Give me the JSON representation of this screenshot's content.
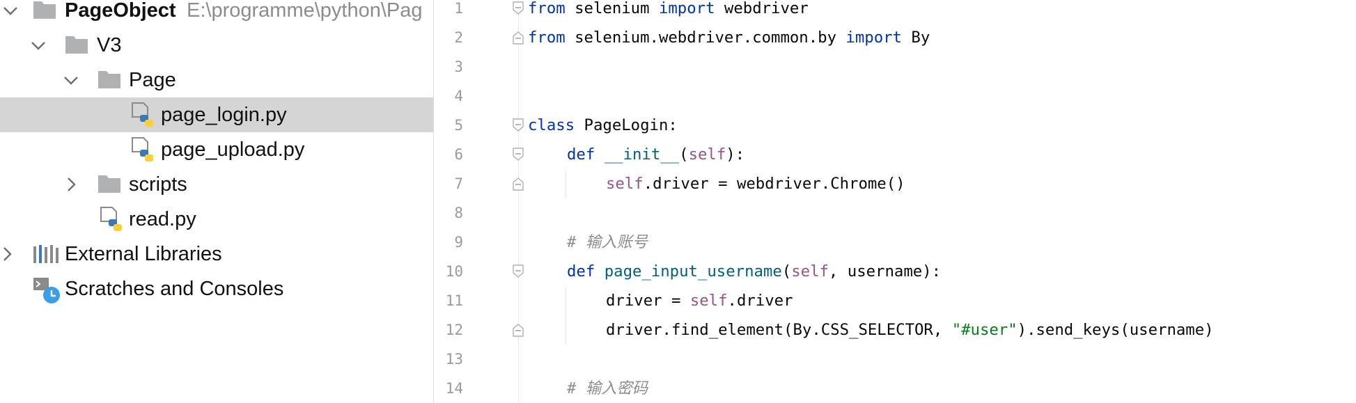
{
  "tree": {
    "project": {
      "name": "PageObject",
      "path": "E:\\programme\\python\\Pag"
    },
    "v3": {
      "name": "V3"
    },
    "page": {
      "name": "Page"
    },
    "page_login": {
      "name": "page_login.py"
    },
    "page_upload": {
      "name": "page_upload.py"
    },
    "scripts": {
      "name": "scripts"
    },
    "read": {
      "name": "read.py"
    },
    "external_libraries": {
      "name": "External Libraries"
    },
    "scratches": {
      "name": "Scratches and Consoles"
    }
  },
  "editor": {
    "line_numbers": [
      "1",
      "2",
      "3",
      "4",
      "5",
      "6",
      "7",
      "8",
      "9",
      "10",
      "11",
      "12",
      "13",
      "14"
    ],
    "lines": {
      "l1": {
        "a": "from",
        "b": " selenium ",
        "c": "import",
        "d": " webdriver"
      },
      "l2": {
        "a": "from",
        "b": " selenium.webdriver.common.by ",
        "c": "import",
        "d": " By"
      },
      "l5": {
        "a": "class",
        "b": " PageLogin:"
      },
      "l6": {
        "a": "def",
        "b": " ",
        "c": "__init__",
        "d": "(",
        "e": "self",
        "f": "):"
      },
      "l7": {
        "a": "self",
        "b": ".driver = webdriver.Chrome()"
      },
      "l9": {
        "a": "# 输入账号"
      },
      "l10": {
        "a": "def",
        "b": " ",
        "c": "page_input_username",
        "d": "(",
        "e": "self",
        "f": ", username):"
      },
      "l11": {
        "a": "driver = ",
        "b": "self",
        "c": ".driver"
      },
      "l12": {
        "a": "driver.find_element(By.CSS_SELECTOR, ",
        "b": "\"#user\"",
        "c": ").send_keys(username)"
      },
      "l14": {
        "a": "# 输入密码"
      }
    }
  },
  "colors": {
    "keyword": "#0033b3",
    "self": "#94558d",
    "function": "#00627a",
    "string": "#067d17",
    "comment": "#8c8c8c",
    "selection": "#d5d5d5",
    "folder": "#afb1b3",
    "python_blue": "#3b78b4",
    "python_yellow": "#ffcf3a"
  },
  "icons": [
    "chevron-down-icon",
    "chevron-right-icon",
    "folder-icon",
    "python-file-icon",
    "library-icon",
    "scratches-icon"
  ]
}
